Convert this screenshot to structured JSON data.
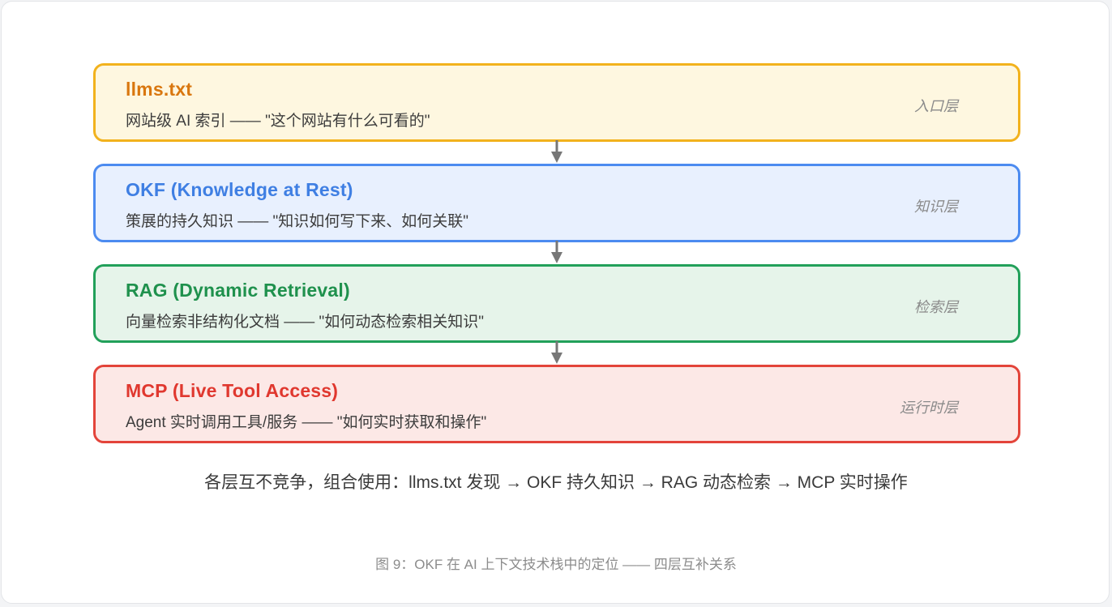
{
  "diagram": {
    "layers": [
      {
        "title": "llms.txt",
        "desc": "网站级 AI 索引 —— \"这个网站有什么可看的\"",
        "tag": "入口层",
        "color": "#d9770f",
        "border": "#f2b21d",
        "bg": "#fef7e0"
      },
      {
        "title": "OKF (Knowledge at Rest)",
        "desc": "策展的持久知识 —— \"知识如何写下来、如何关联\"",
        "tag": "知识层",
        "color": "#3f7fe3",
        "border": "#4c8bf0",
        "bg": "#e8f0fe"
      },
      {
        "title": "RAG (Dynamic Retrieval)",
        "desc": "向量检索非结构化文档 —— \"如何动态检索相关知识\"",
        "tag": "检索层",
        "color": "#1f914d",
        "border": "#22a05a",
        "bg": "#e6f4ea"
      },
      {
        "title": "MCP (Live Tool Access)",
        "desc": "Agent 实时调用工具/服务 —— \"如何实时获取和操作\"",
        "tag": "运行时层",
        "color": "#e0382f",
        "border": "#e3443a",
        "bg": "#fce8e6"
      }
    ],
    "connector_color": "#777777",
    "summary": "各层互不竞争，组合使用：llms.txt 发现 → OKF 持久知识 → RAG 动态检索 → MCP 实时操作",
    "caption": "图 9：OKF 在 AI 上下文技术栈中的定位 —— 四层互补关系"
  }
}
